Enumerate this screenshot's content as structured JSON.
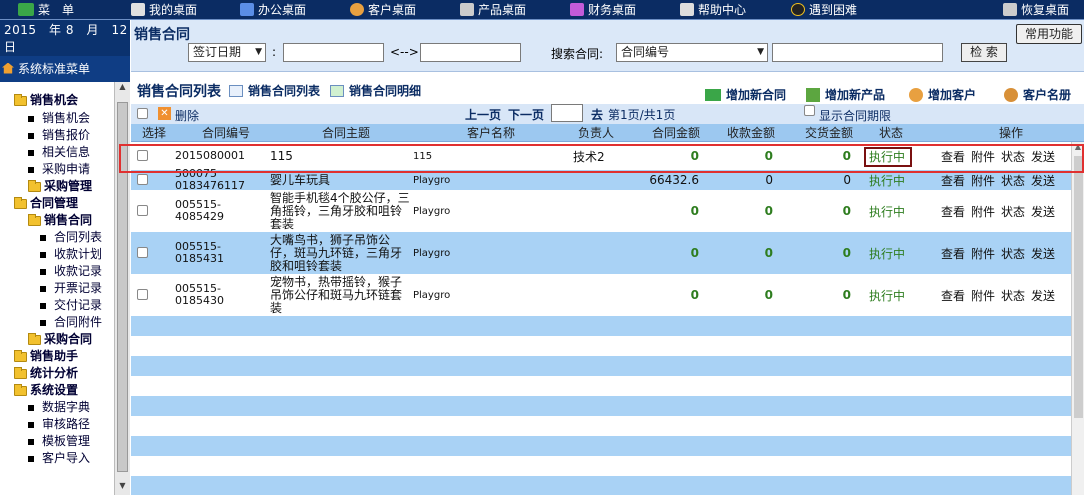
{
  "topnav": {
    "items": [
      {
        "label": "菜　单",
        "icon": "back-arrow-icon",
        "color": "#3aa648"
      },
      {
        "label": "我的桌面",
        "icon": "desktop-icon",
        "color": "#e0e0e0"
      },
      {
        "label": "办公桌面",
        "icon": "chart-icon",
        "color": "#5b8ee6"
      },
      {
        "label": "客户桌面",
        "icon": "users-icon",
        "color": "#e8a040"
      },
      {
        "label": "产品桌面",
        "icon": "cart-icon",
        "color": "#cccccc"
      },
      {
        "label": "财务桌面",
        "icon": "finance-icon",
        "color": "#c35bd8"
      },
      {
        "label": "帮助中心",
        "icon": "book-icon",
        "color": "#dddddd"
      },
      {
        "label": "遇到困难",
        "icon": "penguin-icon",
        "color": "#222222"
      },
      {
        "label": "恢复桌面",
        "icon": "restore-icon",
        "color": "#cccccc"
      }
    ]
  },
  "sidebar": {
    "date": "2015　年 8　月　12　日",
    "menu_title": "系统标准菜单",
    "tree": [
      {
        "label": "销售机会",
        "level": 1,
        "type": "leaf"
      },
      {
        "label": "销售报价",
        "level": 1,
        "type": "leaf"
      },
      {
        "label": "相关信息",
        "level": 1,
        "type": "leaf"
      },
      {
        "label": "采购申请",
        "level": 1,
        "type": "leaf"
      },
      {
        "label": "采购管理",
        "level": 1,
        "type": "folder"
      },
      {
        "label": "合同管理",
        "level": 0,
        "type": "folder"
      },
      {
        "label": "销售合同",
        "level": 1,
        "type": "folder"
      },
      {
        "label": "合同列表",
        "level": 2,
        "type": "leaf"
      },
      {
        "label": "收款计划",
        "level": 2,
        "type": "leaf"
      },
      {
        "label": "收款记录",
        "level": 2,
        "type": "leaf"
      },
      {
        "label": "开票记录",
        "level": 2,
        "type": "leaf"
      },
      {
        "label": "交付记录",
        "level": 2,
        "type": "leaf"
      },
      {
        "label": "合同附件",
        "level": 2,
        "type": "leaf"
      },
      {
        "label": "采购合同",
        "level": 1,
        "type": "folder"
      },
      {
        "label": "销售助手",
        "level": 0,
        "type": "folder"
      },
      {
        "label": "统计分析",
        "level": 0,
        "type": "folder"
      },
      {
        "label": "系统设置",
        "level": 0,
        "type": "folder"
      },
      {
        "label": "数据字典",
        "level": 1,
        "type": "leaf"
      },
      {
        "label": "审核路径",
        "level": 1,
        "type": "leaf"
      },
      {
        "label": "模板管理",
        "level": 1,
        "type": "leaf"
      },
      {
        "label": "客户导入",
        "level": 1,
        "type": "leaf"
      }
    ],
    "first_section": "销售机会"
  },
  "search": {
    "title": "销售合同",
    "common_btn": "常用功能",
    "date_type": "签订日期",
    "colon": ":",
    "range_sep": "<-->",
    "search_label": "搜索合同:",
    "search_field": "合同编号",
    "search_btn": "检 索"
  },
  "listhead": {
    "title": "销售合同列表",
    "links": [
      {
        "label": "销售合同列表",
        "icon": "list-icon"
      },
      {
        "label": "销售合同明细",
        "icon": "detail-icon"
      },
      {
        "label": "增加新合同",
        "icon": "add-contract-icon"
      },
      {
        "label": "增加新产品",
        "icon": "add-product-icon"
      },
      {
        "label": "增加客户",
        "icon": "add-customer-icon"
      },
      {
        "label": "客户名册",
        "icon": "customer-list-icon"
      }
    ]
  },
  "pager": {
    "delete": "删除",
    "prev": "上一页",
    "next": "下一页",
    "go": "去",
    "info": "第1页/共1页",
    "show_expiry": "显示合同期限"
  },
  "table": {
    "headers": [
      "选择",
      "合同编号",
      "合同主题",
      "客户名称",
      "负责人",
      "合同金额",
      "收款金额",
      "交货金额",
      "状态",
      "操作"
    ],
    "ops": [
      "查看",
      "附件",
      "状态",
      "发送"
    ],
    "rows": [
      {
        "id": "2015080001",
        "subject": "115",
        "customer": "115",
        "owner": "技术2",
        "amount": "0",
        "received": "0",
        "delivered": "0",
        "status": "执行中"
      },
      {
        "id": "500075\n0183476117",
        "subject": "婴儿车玩具",
        "customer": "Playgro",
        "owner": "",
        "amount": "66432.6",
        "received": "0",
        "delivered": "0",
        "status": "执行中"
      },
      {
        "id": "005515-4085429",
        "subject": "智能手机毯4个胶公仔，三角摇铃，三角牙胶和咀铃套装",
        "customer": "Playgro",
        "owner": "",
        "amount": "0",
        "received": "0",
        "delivered": "0",
        "status": "执行中"
      },
      {
        "id": "005515-0185431",
        "subject": "大嘴鸟书，狮子吊饰公仔，斑马九环链，三角牙胶和咀铃套装",
        "customer": "Playgro",
        "owner": "",
        "amount": "0",
        "received": "0",
        "delivered": "0",
        "status": "执行中"
      },
      {
        "id": "005515-0185430",
        "subject": "宠物书，热带摇铃，猴子吊饰公仔和斑马九环链套装",
        "customer": "Playgro",
        "owner": "",
        "amount": "0",
        "received": "0",
        "delivered": "0",
        "status": "执行中"
      }
    ]
  },
  "colors": {
    "nav_bg": "#0b2c63",
    "row_blue": "#a9d2f5",
    "row_white": "#ffffff",
    "status_green": "#2e7d1f"
  }
}
